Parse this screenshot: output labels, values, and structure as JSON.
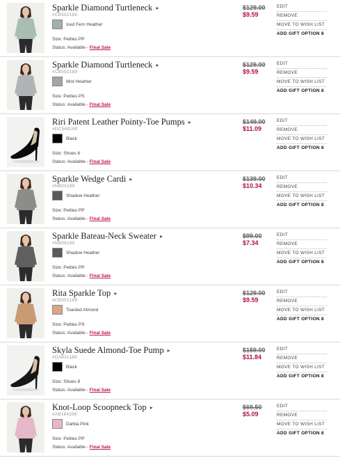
{
  "status_label": "Status: Available - ",
  "final_sale_label": "Final Sale",
  "actions": {
    "edit": "EDIT",
    "remove": "REMOVE",
    "wish": "MOVE TO WISH LIST",
    "gift": "ADD GIFT OPTION 8"
  },
  "items": [
    {
      "name": "Sparkle Diamond Turtleneck",
      "sku": "#CB552189",
      "color": "Iced Fern Heather",
      "swatch": "#9fb1a9",
      "size": "Size: Petites PP",
      "orig": "$129.00",
      "sale": "$9.59",
      "kind": "model",
      "garment": "#a9bdb3",
      "skin": "#e6c3a8"
    },
    {
      "name": "Sparkle Diamond Turtleneck",
      "sku": "#CB552189",
      "color": "Mist Heather",
      "swatch": "#a2a4a6",
      "size": "Size: Petites PS",
      "orig": "$129.00",
      "sale": "$9.59",
      "kind": "model",
      "garment": "#b2b3b5",
      "skin": "#e6c3a8"
    },
    {
      "name": "Riri Patent Leather Pointy-Toe Pumps",
      "sku": "#DC548189",
      "color": "Black",
      "swatch": "#000000",
      "size": "Size: Shoes 6",
      "orig": "$149.00",
      "sale": "$11.09",
      "kind": "shoe",
      "garment": "#0b0b0b",
      "skin": "#e6c3a8"
    },
    {
      "name": "Sparkle Wedge Cardi",
      "sku": "#NB03189",
      "color": "Shadow Heather",
      "swatch": "#5a5a5c",
      "size": "Size: Petites PP",
      "orig": "$139.00",
      "sale": "$10.34",
      "kind": "model",
      "garment": "#8c8c8a",
      "skin": "#e6c3a8"
    },
    {
      "name": "Sparkle Bateau-Neck Sweater",
      "sku": "#NB06189",
      "color": "Shadow Heather",
      "swatch": "#5a5a5c",
      "size": "Size: Petites PP",
      "orig": "$99.00",
      "sale": "$7.34",
      "kind": "model",
      "garment": "#5e5f61",
      "skin": "#e6c3a8"
    },
    {
      "name": "Rita Sparkle Top",
      "sku": "#CB502189",
      "color": "Toasted Almond",
      "swatch": "#d9a585",
      "size": "Size: Petites PS",
      "orig": "$129.00",
      "sale": "$9.59",
      "kind": "model",
      "garment": "#c99b75",
      "skin": "#e6c3a8"
    },
    {
      "name": "Skyla Suede Almond-Toe Pump",
      "sku": "#DA831188",
      "color": "Black",
      "swatch": "#000000",
      "size": "Size: Shoes 8",
      "orig": "$159.00",
      "sale": "$11.84",
      "kind": "shoe",
      "garment": "#161616",
      "skin": "#e6c3a8"
    },
    {
      "name": "Knot-Loop Scoopneck Top",
      "sku": "#AB164286",
      "color": "Dahlia Pink",
      "swatch": "#e8b7c4",
      "size": "Size: Petites PP",
      "orig": "$69.50",
      "sale": "$5.09",
      "kind": "model",
      "garment": "#e4b8c6",
      "skin": "#e6c3a8"
    }
  ]
}
